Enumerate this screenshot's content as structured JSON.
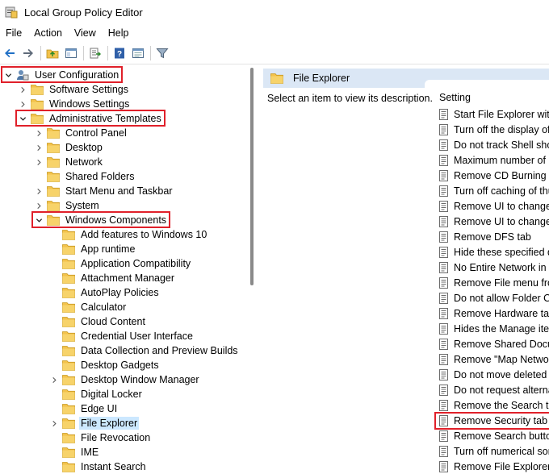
{
  "window": {
    "title": "Local Group Policy Editor"
  },
  "menubar": [
    "File",
    "Action",
    "View",
    "Help"
  ],
  "toolbar": [
    "back-icon",
    "forward-icon",
    "up-folder-icon",
    "show-hide-tree-icon",
    "export-list-icon",
    "help-icon",
    "properties-icon",
    "filter-icon"
  ],
  "tree": [
    {
      "label": "User Configuration",
      "depth": 0,
      "chevron": "down",
      "icon": "user-config-icon",
      "highlight": true
    },
    {
      "label": "Software Settings",
      "depth": 1,
      "chevron": "right",
      "icon": "folder-icon"
    },
    {
      "label": "Windows Settings",
      "depth": 1,
      "chevron": "right",
      "icon": "folder-icon"
    },
    {
      "label": "Administrative Templates",
      "depth": 1,
      "chevron": "down",
      "icon": "folder-icon",
      "highlight": true
    },
    {
      "label": "Control Panel",
      "depth": 2,
      "chevron": "right",
      "icon": "folder-icon"
    },
    {
      "label": "Desktop",
      "depth": 2,
      "chevron": "right",
      "icon": "folder-icon"
    },
    {
      "label": "Network",
      "depth": 2,
      "chevron": "right",
      "icon": "folder-icon"
    },
    {
      "label": "Shared Folders",
      "depth": 2,
      "chevron": "",
      "icon": "folder-icon"
    },
    {
      "label": "Start Menu and Taskbar",
      "depth": 2,
      "chevron": "right",
      "icon": "folder-icon"
    },
    {
      "label": "System",
      "depth": 2,
      "chevron": "right",
      "icon": "folder-icon"
    },
    {
      "label": "Windows Components",
      "depth": 2,
      "chevron": "down",
      "icon": "folder-icon",
      "highlight": true
    },
    {
      "label": "Add features to Windows 10",
      "depth": 3,
      "chevron": "",
      "icon": "folder-icon"
    },
    {
      "label": "App runtime",
      "depth": 3,
      "chevron": "",
      "icon": "folder-icon"
    },
    {
      "label": "Application Compatibility",
      "depth": 3,
      "chevron": "",
      "icon": "folder-icon"
    },
    {
      "label": "Attachment Manager",
      "depth": 3,
      "chevron": "",
      "icon": "folder-icon"
    },
    {
      "label": "AutoPlay Policies",
      "depth": 3,
      "chevron": "",
      "icon": "folder-icon"
    },
    {
      "label": "Calculator",
      "depth": 3,
      "chevron": "",
      "icon": "folder-icon"
    },
    {
      "label": "Cloud Content",
      "depth": 3,
      "chevron": "",
      "icon": "folder-icon"
    },
    {
      "label": "Credential User Interface",
      "depth": 3,
      "chevron": "",
      "icon": "folder-icon"
    },
    {
      "label": "Data Collection and Preview Builds",
      "depth": 3,
      "chevron": "",
      "icon": "folder-icon"
    },
    {
      "label": "Desktop Gadgets",
      "depth": 3,
      "chevron": "",
      "icon": "folder-icon"
    },
    {
      "label": "Desktop Window Manager",
      "depth": 3,
      "chevron": "right",
      "icon": "folder-icon"
    },
    {
      "label": "Digital Locker",
      "depth": 3,
      "chevron": "",
      "icon": "folder-icon"
    },
    {
      "label": "Edge UI",
      "depth": 3,
      "chevron": "",
      "icon": "folder-icon"
    },
    {
      "label": "File Explorer",
      "depth": 3,
      "chevron": "right",
      "icon": "folder-icon",
      "selected": true
    },
    {
      "label": "File Revocation",
      "depth": 3,
      "chevron": "",
      "icon": "folder-icon"
    },
    {
      "label": "IME",
      "depth": 3,
      "chevron": "",
      "icon": "folder-icon"
    },
    {
      "label": "Instant Search",
      "depth": 3,
      "chevron": "",
      "icon": "folder-icon"
    }
  ],
  "right_pane": {
    "header_title": "File Explorer",
    "description": "Select an item to view its description.",
    "column_header": "Setting",
    "settings": [
      {
        "label": "Start File Explorer with"
      },
      {
        "label": "Turn off the display of s"
      },
      {
        "label": "Do not track Shell shor"
      },
      {
        "label": "Maximum number of r"
      },
      {
        "label": "Remove CD Burning fe"
      },
      {
        "label": "Turn off caching of thu"
      },
      {
        "label": "Remove UI to change r"
      },
      {
        "label": "Remove UI to change k"
      },
      {
        "label": "Remove DFS tab"
      },
      {
        "label": "Hide these specified dr"
      },
      {
        "label": "No Entire Network in N"
      },
      {
        "label": "Remove File menu fron"
      },
      {
        "label": "Do not allow Folder Op"
      },
      {
        "label": "Remove Hardware tab"
      },
      {
        "label": "Hides the Manage item"
      },
      {
        "label": "Remove Shared Docum"
      },
      {
        "label": "Remove \"Map Network"
      },
      {
        "label": "Do not move deleted fi"
      },
      {
        "label": "Do not request alternat"
      },
      {
        "label": "Remove the Search the"
      },
      {
        "label": "Remove Security tab",
        "highlight": true
      },
      {
        "label": "Remove Search button"
      },
      {
        "label": "Turn off numerical sort"
      },
      {
        "label": "Remove File Explorer's"
      }
    ]
  },
  "colors": {
    "highlight_box": "#e0202a",
    "selection": "#cce8ff",
    "header_bg": "#dbe7f5",
    "folder": "#f3c24b"
  }
}
